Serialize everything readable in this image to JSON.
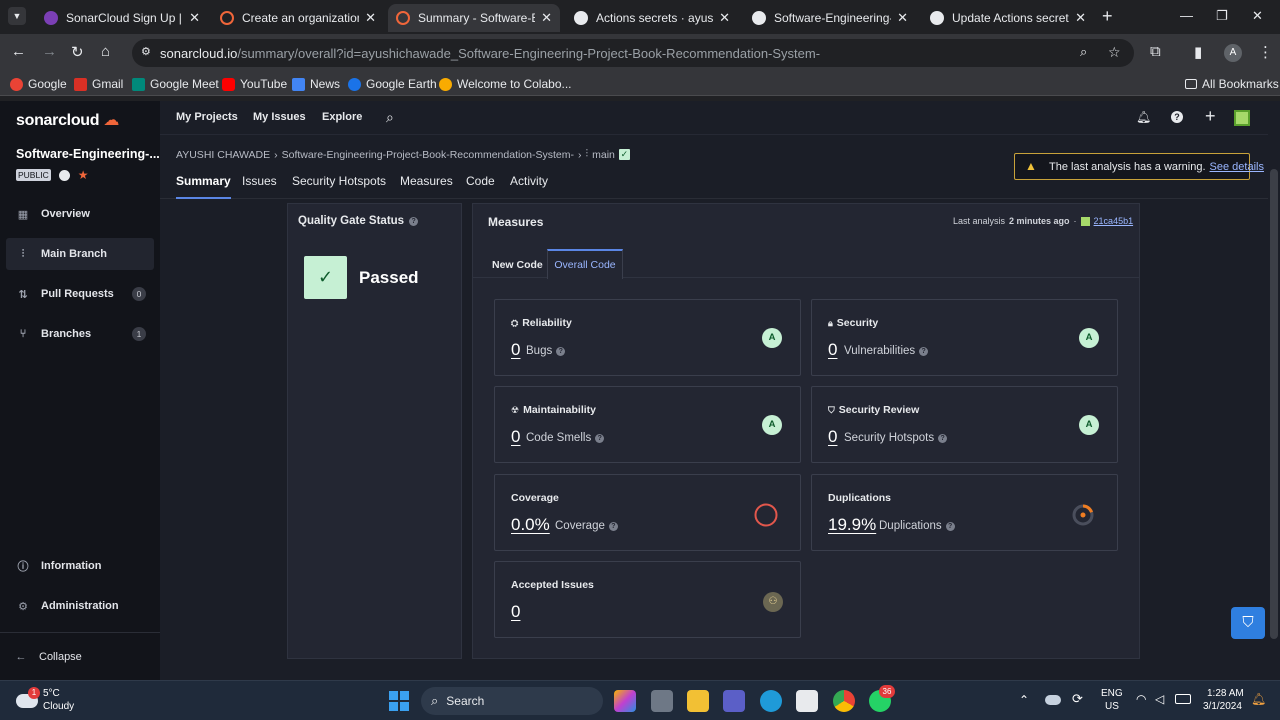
{
  "browser": {
    "tabs": [
      {
        "title": "SonarCloud Sign Up | Sona",
        "active": false
      },
      {
        "title": "Create an organization - So",
        "active": false
      },
      {
        "title": "Summary - Software-Engin",
        "active": true
      },
      {
        "title": "Actions secrets · ayushicha",
        "active": false
      },
      {
        "title": "Software-Engineering-Proj",
        "active": false
      },
      {
        "title": "Update Actions secret SON",
        "active": false
      }
    ],
    "url_host": "sonarcloud.io",
    "url_path": "/summary/overall?id=ayushichawade_Software-Engineering-Project-Book-Recommendation-System-",
    "profile_initial": "A",
    "bookmarks": [
      "Google",
      "Gmail",
      "Google Meet",
      "YouTube",
      "News",
      "Google Earth",
      "Welcome to Colabo..."
    ],
    "all_bookmarks": "All Bookmarks"
  },
  "app": {
    "logo": "sonarcloud",
    "nav": [
      "My Projects",
      "My Issues",
      "Explore"
    ],
    "project_name": "Software-Engineering-...",
    "public_badge": "PUBLIC",
    "sidebar": [
      {
        "label": "Overview",
        "count": null
      },
      {
        "label": "Main Branch",
        "count": null
      },
      {
        "label": "Pull Requests",
        "count": "0"
      },
      {
        "label": "Branches",
        "count": "1"
      }
    ],
    "sidebar_bottom": [
      "Information",
      "Administration"
    ],
    "collapse": "Collapse",
    "breadcrumb": {
      "org": "AYUSHI CHAWADE",
      "project": "Software-Engineering-Project-Book-Recommendation-System-",
      "branch": "main"
    },
    "project_tabs": [
      "Summary",
      "Issues",
      "Security Hotspots",
      "Measures",
      "Code",
      "Activity"
    ],
    "warning": {
      "text": "The last analysis has a warning.",
      "link": "See details"
    }
  },
  "quality_gate": {
    "title": "Quality Gate Status",
    "status": "Passed"
  },
  "measures": {
    "title": "Measures",
    "last_analysis_prefix": "Last analysis",
    "last_analysis_time": "2 minutes ago",
    "commit": "21ca45b1",
    "tabs": [
      "New Code",
      "Overall Code"
    ],
    "cards": {
      "reliability": {
        "title": "Reliability",
        "value": "0",
        "label": "Bugs",
        "grade": "A"
      },
      "security": {
        "title": "Security",
        "value": "0",
        "label": "Vulnerabilities",
        "grade": "A"
      },
      "maintainability": {
        "title": "Maintainability",
        "value": "0",
        "label": "Code Smells",
        "grade": "A"
      },
      "security_review": {
        "title": "Security Review",
        "value": "0",
        "label": "Security Hotspots",
        "grade": "A"
      },
      "coverage": {
        "title": "Coverage",
        "value": "0.0%",
        "label": "Coverage",
        "percent": 0
      },
      "duplications": {
        "title": "Duplications",
        "value": "19.9%",
        "label": "Duplications",
        "percent": 19.9
      },
      "accepted": {
        "title": "Accepted Issues",
        "value": "0"
      }
    }
  },
  "taskbar": {
    "weather_temp": "5°C",
    "weather_desc": "Cloudy",
    "weather_badge": "1",
    "search": "Search",
    "whatsapp_badge": "36",
    "lang_line1": "ENG",
    "lang_line2": "US",
    "time": "1:28 AM",
    "date": "3/1/2024"
  }
}
